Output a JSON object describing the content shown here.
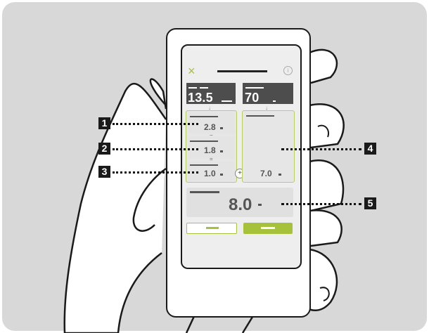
{
  "header": {
    "close_icon": "×",
    "info_icon": "i"
  },
  "top_left_value": "13.5",
  "top_right_value": "70",
  "sub_items": [
    {
      "value": "2.8"
    },
    {
      "value": "1.8"
    },
    {
      "value": "1.0"
    }
  ],
  "operators": {
    "minus1": "−",
    "minus2": "=",
    "plus": "+",
    "arrow": "↓"
  },
  "right_panel_value": "7.0",
  "result_value": "8.0",
  "callouts": [
    "1",
    "2",
    "3",
    "4",
    "5"
  ],
  "colors": {
    "accent": "#a6c23a",
    "dark": "#4d4d4d",
    "outline": "#b7cf5b"
  }
}
